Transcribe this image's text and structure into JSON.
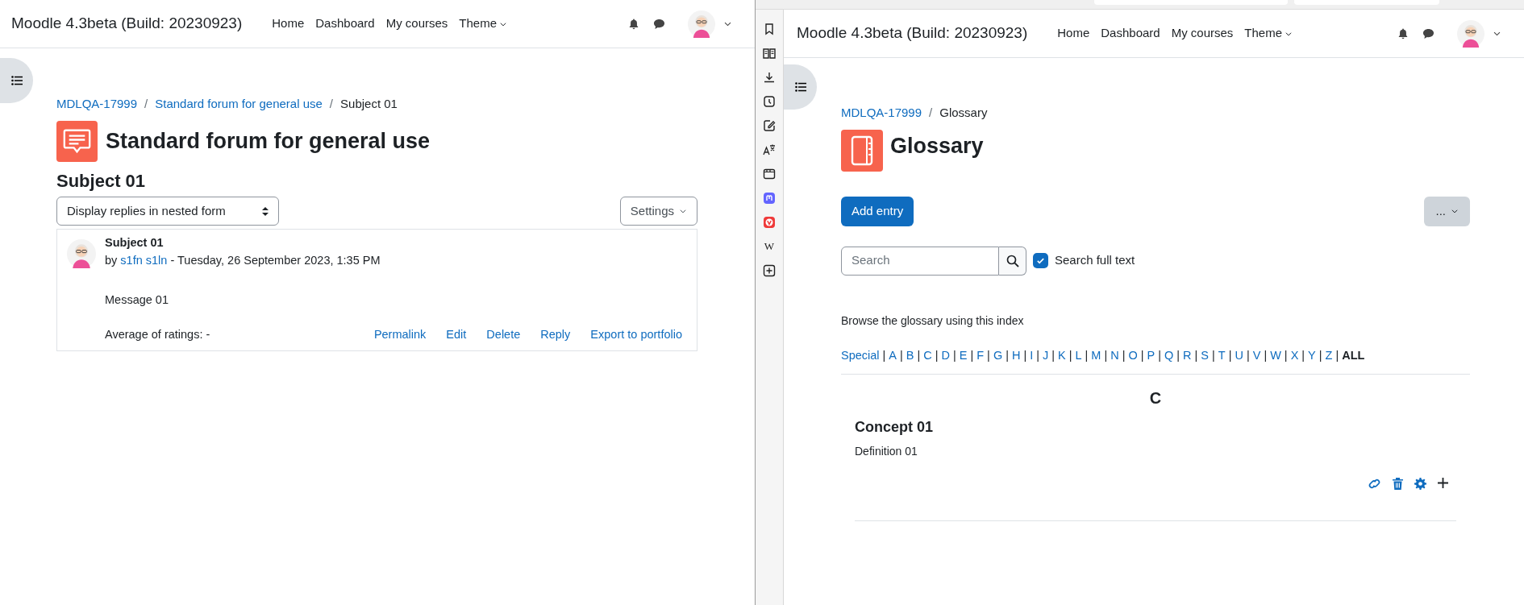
{
  "left_window": {
    "header": {
      "site_name": "Moodle 4.3beta (Build: 20230923)",
      "nav": [
        {
          "label": "Home",
          "dropdown": false
        },
        {
          "label": "Dashboard",
          "dropdown": false
        },
        {
          "label": "My courses",
          "dropdown": false
        },
        {
          "label": "Theme",
          "dropdown": true
        }
      ]
    },
    "breadcrumb": [
      {
        "label": "MDLQA-17999",
        "link": true,
        "separator": "/"
      },
      {
        "label": "Standard forum for general use",
        "link": true,
        "separator": "/"
      },
      {
        "label": "Subject 01",
        "link": false
      }
    ],
    "title": "Standard forum for general use",
    "discussion_title": "Subject 01",
    "display_mode": "Display replies in nested form",
    "settings_button": "Settings",
    "post": {
      "subject": "Subject 01",
      "by": "by",
      "author": "s1fn s1ln",
      "date": "- Tuesday, 26 September 2023, 1:35 PM",
      "message": "Message 01",
      "ratings": "Average of ratings: -",
      "actions": [
        "Permalink",
        "Edit",
        "Delete",
        "Reply",
        "Export to portfolio"
      ]
    }
  },
  "browser_sidebar": {
    "panels": [
      {
        "kind": "bookmark"
      },
      {
        "kind": "reader"
      },
      {
        "kind": "download"
      },
      {
        "kind": "history"
      },
      {
        "kind": "notes"
      },
      {
        "kind": "translate"
      },
      {
        "kind": "window"
      },
      {
        "kind": "mastodon"
      },
      {
        "kind": "vivaldi"
      },
      {
        "kind": "glyph",
        "glyph": "W"
      },
      {
        "kind": "add"
      }
    ]
  },
  "right_window": {
    "header": {
      "site_name": "Moodle 4.3beta (Build: 20230923)",
      "nav": [
        {
          "label": "Home",
          "dropdown": false
        },
        {
          "label": "Dashboard",
          "dropdown": false
        },
        {
          "label": "My courses",
          "dropdown": false
        },
        {
          "label": "Theme",
          "dropdown": true
        }
      ]
    },
    "breadcrumb": [
      {
        "label": "MDLQA-17999",
        "link": true,
        "separator": "/"
      },
      {
        "label": "Glossary",
        "link": false
      }
    ],
    "title": "Glossary",
    "add_entry_button": "Add entry",
    "more_button": "...",
    "search": {
      "placeholder": "Search"
    },
    "search_full_text": {
      "label": "Search full text",
      "checked": true
    },
    "browse_label": "Browse the glossary using this index",
    "index": [
      {
        "label": "Special",
        "selected": false,
        "separator": "|"
      },
      {
        "label": "A",
        "selected": false,
        "separator": "|"
      },
      {
        "label": "B",
        "selected": false,
        "separator": "|"
      },
      {
        "label": "C",
        "selected": false,
        "separator": "|"
      },
      {
        "label": "D",
        "selected": false,
        "separator": "|"
      },
      {
        "label": "E",
        "selected": false,
        "separator": "|"
      },
      {
        "label": "F",
        "selected": false,
        "separator": "|"
      },
      {
        "label": "G",
        "selected": false,
        "separator": "|"
      },
      {
        "label": "H",
        "selected": false,
        "separator": "|"
      },
      {
        "label": "I",
        "selected": false,
        "separator": "|"
      },
      {
        "label": "J",
        "selected": false,
        "separator": "|"
      },
      {
        "label": "K",
        "selected": false,
        "separator": "|"
      },
      {
        "label": "L",
        "selected": false,
        "separator": "|"
      },
      {
        "label": "M",
        "selected": false,
        "separator": "|"
      },
      {
        "label": "N",
        "selected": false,
        "separator": "|"
      },
      {
        "label": "O",
        "selected": false,
        "separator": "|"
      },
      {
        "label": "P",
        "selected": false,
        "separator": "|"
      },
      {
        "label": "Q",
        "selected": false,
        "separator": "|"
      },
      {
        "label": "R",
        "selected": false,
        "separator": "|"
      },
      {
        "label": "S",
        "selected": false,
        "separator": "|"
      },
      {
        "label": "T",
        "selected": false,
        "separator": "|"
      },
      {
        "label": "U",
        "selected": false,
        "separator": "|"
      },
      {
        "label": "V",
        "selected": false,
        "separator": "|"
      },
      {
        "label": "W",
        "selected": false,
        "separator": "|"
      },
      {
        "label": "X",
        "selected": false,
        "separator": "|"
      },
      {
        "label": "Y",
        "selected": false,
        "separator": "|"
      },
      {
        "label": "Z",
        "selected": false,
        "separator": "|"
      },
      {
        "label": "ALL",
        "selected": true
      }
    ],
    "letter_heading": "C",
    "entries": [
      {
        "concept": "Concept 01",
        "definition": "Definition 01"
      }
    ]
  }
}
